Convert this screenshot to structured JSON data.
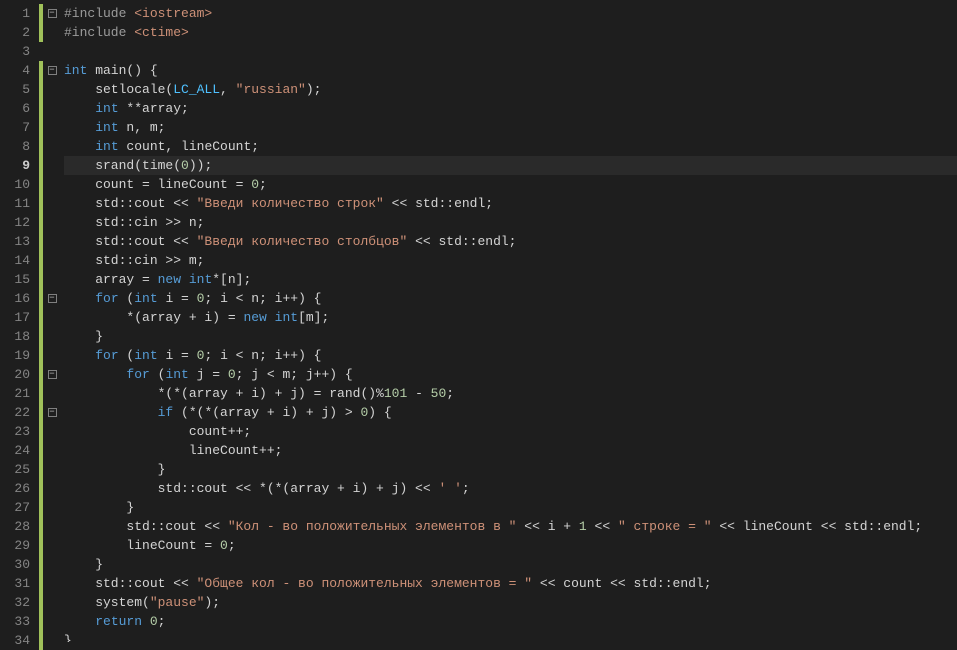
{
  "editor": {
    "line_count": 34,
    "highlighted_line": 9,
    "fold_markers": {
      "1": "minus",
      "4": "minus",
      "16": "minus",
      "20": "minus",
      "22": "minus"
    },
    "modified_lines": [
      1,
      2,
      4,
      5,
      6,
      7,
      8,
      9,
      10,
      11,
      12,
      13,
      14,
      15,
      16,
      17,
      18,
      19,
      20,
      21,
      22,
      23,
      24,
      25,
      26,
      27,
      28,
      29,
      30,
      31,
      32,
      33,
      34
    ],
    "lines": {
      "1": [
        {
          "t": "ppg",
          "v": "#include "
        },
        {
          "t": "st",
          "v": "<iostream>"
        }
      ],
      "2": [
        {
          "t": "ppg",
          "v": "#include "
        },
        {
          "t": "st",
          "v": "<ctime>"
        }
      ],
      "3": [],
      "4": [
        {
          "t": "kw",
          "v": "int"
        },
        {
          "t": "id",
          "v": " main() {"
        }
      ],
      "5": [
        {
          "t": "id",
          "v": "    setlocale("
        },
        {
          "t": "mc2",
          "v": "LC_ALL"
        },
        {
          "t": "id",
          "v": ", "
        },
        {
          "t": "st",
          "v": "\"russian\""
        },
        {
          "t": "id",
          "v": ");"
        }
      ],
      "6": [
        {
          "t": "id",
          "v": "    "
        },
        {
          "t": "kw",
          "v": "int"
        },
        {
          "t": "id",
          "v": " **array;"
        }
      ],
      "7": [
        {
          "t": "id",
          "v": "    "
        },
        {
          "t": "kw",
          "v": "int"
        },
        {
          "t": "id",
          "v": " n, m;"
        }
      ],
      "8": [
        {
          "t": "id",
          "v": "    "
        },
        {
          "t": "kw",
          "v": "int"
        },
        {
          "t": "id",
          "v": " count, lineCount;"
        }
      ],
      "9": [
        {
          "t": "id",
          "v": "    srand(time("
        },
        {
          "t": "nm",
          "v": "0"
        },
        {
          "t": "id",
          "v": "));"
        }
      ],
      "10": [
        {
          "t": "id",
          "v": "    count = lineCount = "
        },
        {
          "t": "nm",
          "v": "0"
        },
        {
          "t": "id",
          "v": ";"
        }
      ],
      "11": [
        {
          "t": "id",
          "v": "    std::cout << "
        },
        {
          "t": "st",
          "v": "\"Введи количество строк\""
        },
        {
          "t": "id",
          "v": " << std::endl;"
        }
      ],
      "12": [
        {
          "t": "id",
          "v": "    std::cin >> n;"
        }
      ],
      "13": [
        {
          "t": "id",
          "v": "    std::cout << "
        },
        {
          "t": "st",
          "v": "\"Введи количество столбцов\""
        },
        {
          "t": "id",
          "v": " << std::endl;"
        }
      ],
      "14": [
        {
          "t": "id",
          "v": "    std::cin >> m;"
        }
      ],
      "15": [
        {
          "t": "id",
          "v": "    array = "
        },
        {
          "t": "kw",
          "v": "new"
        },
        {
          "t": "id",
          "v": " "
        },
        {
          "t": "kw",
          "v": "int"
        },
        {
          "t": "id",
          "v": "*[n];"
        }
      ],
      "16": [
        {
          "t": "id",
          "v": "    "
        },
        {
          "t": "kw",
          "v": "for"
        },
        {
          "t": "id",
          "v": " ("
        },
        {
          "t": "kw",
          "v": "int"
        },
        {
          "t": "id",
          "v": " i = "
        },
        {
          "t": "nm",
          "v": "0"
        },
        {
          "t": "id",
          "v": "; i < n; i++) {"
        }
      ],
      "17": [
        {
          "t": "id",
          "v": "        *(array + i) = "
        },
        {
          "t": "kw",
          "v": "new"
        },
        {
          "t": "id",
          "v": " "
        },
        {
          "t": "kw",
          "v": "int"
        },
        {
          "t": "id",
          "v": "[m];"
        }
      ],
      "18": [
        {
          "t": "id",
          "v": "    }"
        }
      ],
      "19": [
        {
          "t": "id",
          "v": "    "
        },
        {
          "t": "kw",
          "v": "for"
        },
        {
          "t": "id",
          "v": " ("
        },
        {
          "t": "kw",
          "v": "int"
        },
        {
          "t": "id",
          "v": " i = "
        },
        {
          "t": "nm",
          "v": "0"
        },
        {
          "t": "id",
          "v": "; i < n; i++) {"
        }
      ],
      "20": [
        {
          "t": "id",
          "v": "        "
        },
        {
          "t": "kw",
          "v": "for"
        },
        {
          "t": "id",
          "v": " ("
        },
        {
          "t": "kw",
          "v": "int"
        },
        {
          "t": "id",
          "v": " j = "
        },
        {
          "t": "nm",
          "v": "0"
        },
        {
          "t": "id",
          "v": "; j < m; j++) {"
        }
      ],
      "21": [
        {
          "t": "id",
          "v": "            *(*(array + i) + j) = rand()%"
        },
        {
          "t": "nm",
          "v": "101"
        },
        {
          "t": "id",
          "v": " - "
        },
        {
          "t": "nm",
          "v": "50"
        },
        {
          "t": "id",
          "v": ";"
        }
      ],
      "22": [
        {
          "t": "id",
          "v": "            "
        },
        {
          "t": "kw",
          "v": "if"
        },
        {
          "t": "id",
          "v": " (*(*(array + i) + j) > "
        },
        {
          "t": "nm",
          "v": "0"
        },
        {
          "t": "id",
          "v": ") {"
        }
      ],
      "23": [
        {
          "t": "id",
          "v": "                count++;"
        }
      ],
      "24": [
        {
          "t": "id",
          "v": "                lineCount++;"
        }
      ],
      "25": [
        {
          "t": "id",
          "v": "            }"
        }
      ],
      "26": [
        {
          "t": "id",
          "v": "            std::cout << *(*(array + i) + j) << "
        },
        {
          "t": "st",
          "v": "' '"
        },
        {
          "t": "id",
          "v": ";"
        }
      ],
      "27": [
        {
          "t": "id",
          "v": "        }"
        }
      ],
      "28": [
        {
          "t": "id",
          "v": "        std::cout << "
        },
        {
          "t": "st",
          "v": "\"Кол - во положительных элементов в \""
        },
        {
          "t": "id",
          "v": " << i + "
        },
        {
          "t": "nm",
          "v": "1"
        },
        {
          "t": "id",
          "v": " << "
        },
        {
          "t": "st",
          "v": "\" строке = \""
        },
        {
          "t": "id",
          "v": " << lineCount << std::endl;"
        }
      ],
      "29": [
        {
          "t": "id",
          "v": "        lineCount = "
        },
        {
          "t": "nm",
          "v": "0"
        },
        {
          "t": "id",
          "v": ";"
        }
      ],
      "30": [
        {
          "t": "id",
          "v": "    }"
        }
      ],
      "31": [
        {
          "t": "id",
          "v": "    std::cout << "
        },
        {
          "t": "st",
          "v": "\"Общее кол - во положительных элементов = \""
        },
        {
          "t": "id",
          "v": " << count << std::endl;"
        }
      ],
      "32": [
        {
          "t": "id",
          "v": "    system("
        },
        {
          "t": "st",
          "v": "\"pause\""
        },
        {
          "t": "id",
          "v": ");"
        }
      ],
      "33": [
        {
          "t": "id",
          "v": "    "
        },
        {
          "t": "kw",
          "v": "return"
        },
        {
          "t": "id",
          "v": " "
        },
        {
          "t": "nm",
          "v": "0"
        },
        {
          "t": "id",
          "v": ";"
        }
      ],
      "34": [
        {
          "t": "id",
          "v": "}"
        }
      ]
    }
  }
}
